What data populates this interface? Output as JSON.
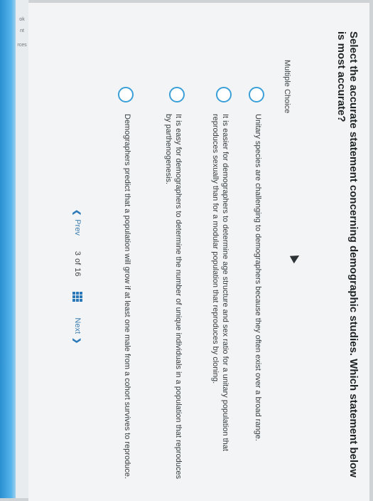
{
  "sidebar": {
    "frag_1": "ok",
    "frag_2": "nt",
    "frag_3": "rces"
  },
  "question": {
    "text": "Select the accurate statement concerning demographic studies. Which statement below is most accurate?",
    "type_label": "Multiple Choice"
  },
  "options": [
    {
      "text": "Unitary species are challenging to demographers because they often exist over a broad range."
    },
    {
      "text": "It is easier for demographers to determine age structure and sex ratio for a unitary population that reproduces sexually than for a modular population that reproduces by cloning."
    },
    {
      "text": "It is easy for demographers to determine the number of unique individuals in a population that reproduces by parthenogenesis."
    },
    {
      "text": "Demographers predict that a population will grow if at least one male from a cohort survives to reproduce."
    }
  ],
  "pager": {
    "prev_label": "Prev",
    "current": "3",
    "of_label": "of",
    "total": "16",
    "next_label": "Next"
  },
  "colors": {
    "accent": "#3b9fd8",
    "bezel": "#2a8fd0"
  }
}
